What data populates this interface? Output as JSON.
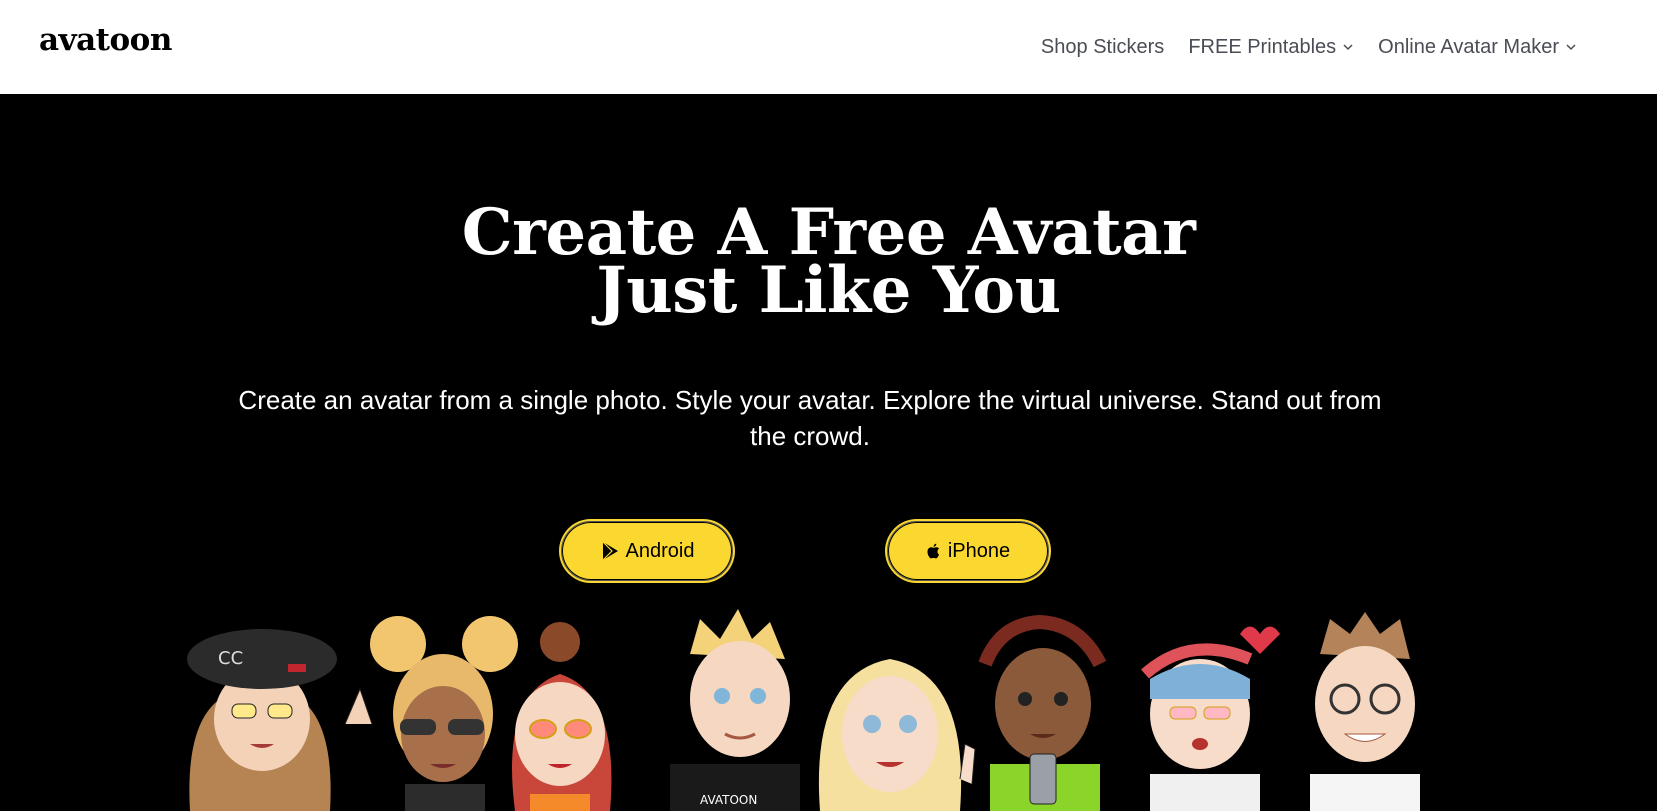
{
  "header": {
    "logo": "avatoon",
    "nav": {
      "shop_stickers": "Shop Stickers",
      "free_printables": "FREE Printables",
      "online_avatar_maker": "Online Avatar Maker"
    }
  },
  "hero": {
    "title_line1": "Create A Free Avatar",
    "title_line2": "Just Like You",
    "subtitle": "Create an avatar from a single photo. Style your avatar. Explore the virtual universe. Stand out from the crowd.",
    "buttons": {
      "android": "Android",
      "iphone": "iPhone"
    }
  },
  "colors": {
    "button_bg": "#fbd82f",
    "hero_bg": "#000000",
    "nav_text": "#4a4d55"
  },
  "icons": {
    "android_button_icon": "play-store-icon",
    "iphone_button_icon": "apple-icon",
    "dropdown_icon": "chevron-down-icon"
  }
}
